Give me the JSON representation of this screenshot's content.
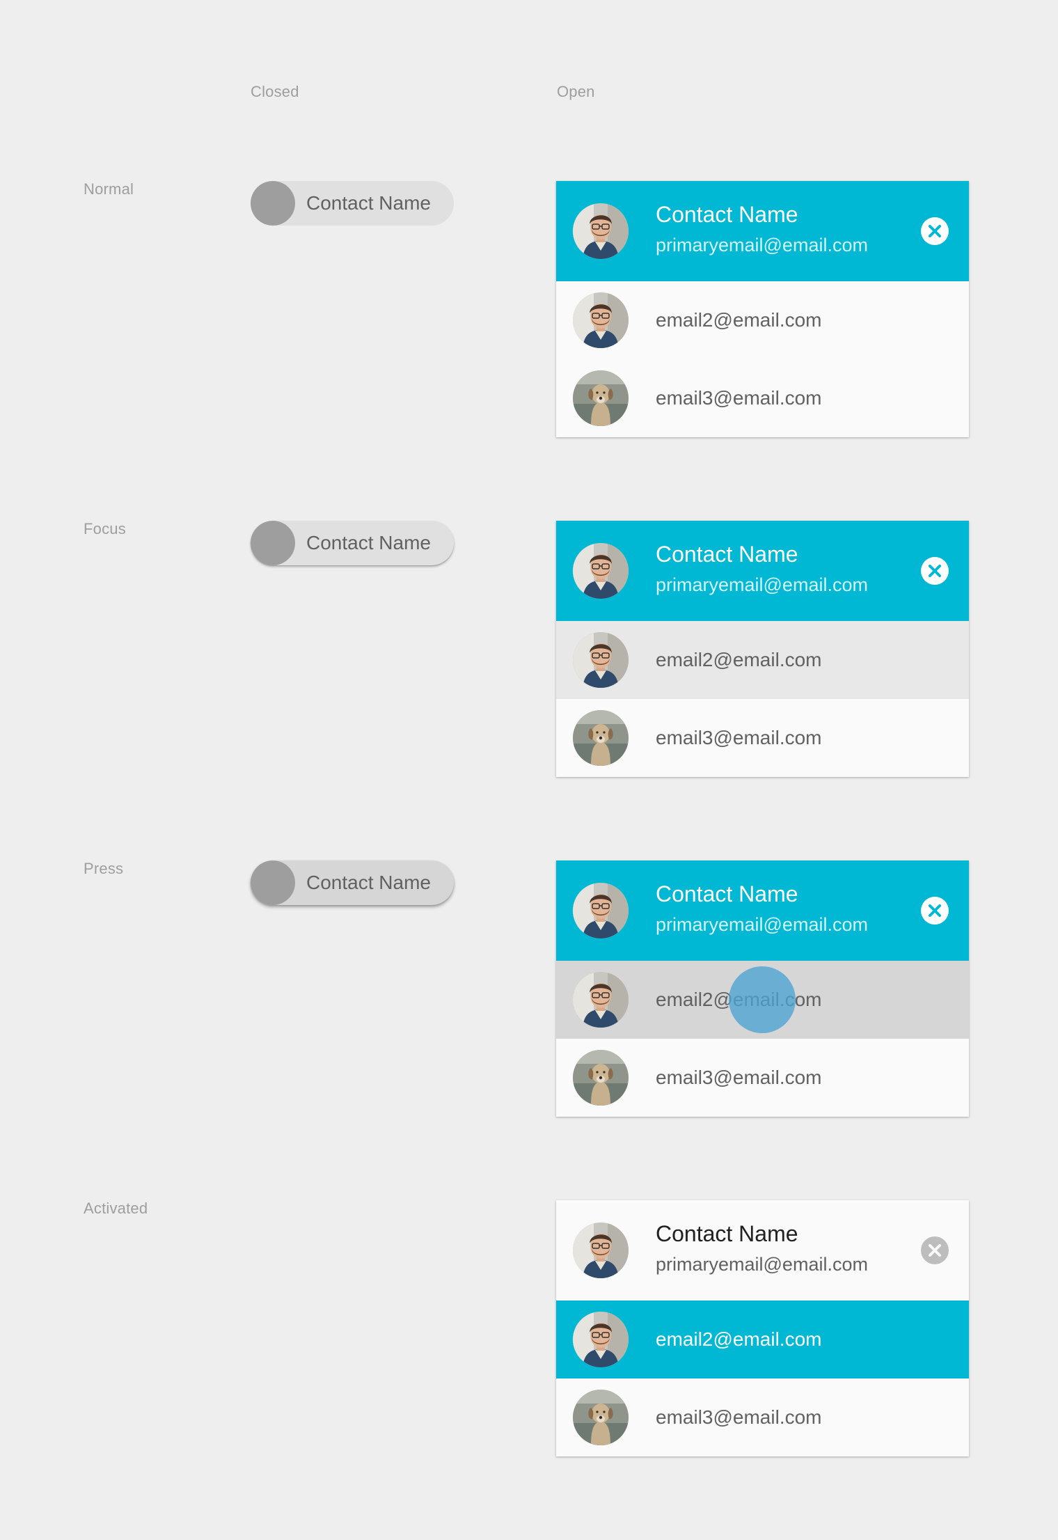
{
  "columns": {
    "closed": "Closed",
    "open": "Open"
  },
  "states": {
    "normal": "Normal",
    "focus": "Focus",
    "press": "Press",
    "activated": "Activated"
  },
  "chip": {
    "label": "Contact Name"
  },
  "contact": {
    "name": "Contact Name",
    "primary_email": "primaryemail@email.com",
    "emails": [
      "email2@email.com",
      "email3@email.com"
    ]
  },
  "colors": {
    "accent": "#00b8d4",
    "background": "#eeeeee",
    "card": "#fafafa",
    "focus_row": "#e8e8e8",
    "pressed_row": "#d6d6d6",
    "ripple": "#4da3d4"
  },
  "icons": {
    "remove": "close-circle-icon"
  }
}
